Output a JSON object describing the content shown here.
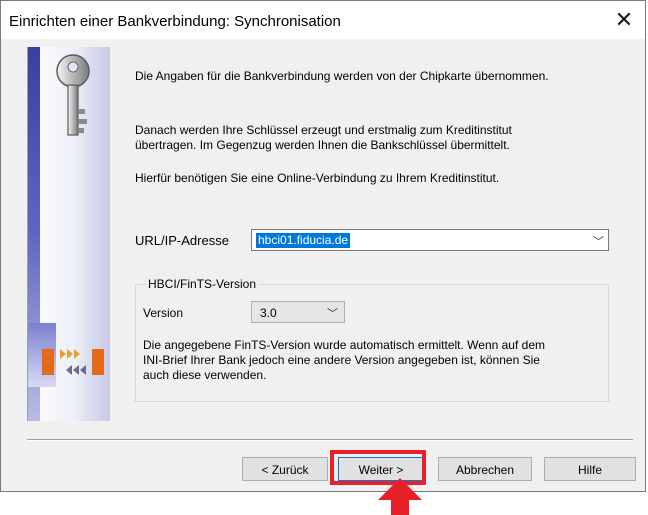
{
  "window": {
    "title": "Einrichten einer Bankverbindung: Synchronisation",
    "close_glyph": "✕"
  },
  "content": {
    "para1": "Die Angaben für die Bankverbindung werden von der Chipkarte übernommen.",
    "para2_line1": "Danach werden Ihre Schlüssel erzeugt und erstmalig zum Kreditinstitut",
    "para2_line2": "übertragen. Im Gegenzug werden Ihnen die Bankschlüssel übermittelt.",
    "para3": "Hierfür benötigen Sie eine Online-Verbindung zu Ihrem Kreditinstitut."
  },
  "url": {
    "label": "URL/IP-Adresse",
    "value": "hbci01.fiducia.de"
  },
  "fints_group": {
    "title": "HBCI/FinTS-Version",
    "version_label": "Version",
    "version_value": "3.0",
    "note_line1": "Die angegebene FinTS-Version wurde automatisch ermittelt. Wenn auf dem",
    "note_line2": "INI-Brief Ihrer Bank jedoch eine andere Version angegeben ist, können Sie",
    "note_line3": "auch diese verwenden."
  },
  "buttons": {
    "back": "< Zurück",
    "next": "Weiter >",
    "cancel": "Abbrechen",
    "help": "Hilfe"
  },
  "icons": {
    "side_top": "key-icon",
    "side_bottom": "transfer-icon",
    "annotation": "red-arrow-up-icon"
  },
  "colors": {
    "selection": "#0078d7",
    "highlight": "#e8202a",
    "side_stripe": "#3a3f9e"
  }
}
